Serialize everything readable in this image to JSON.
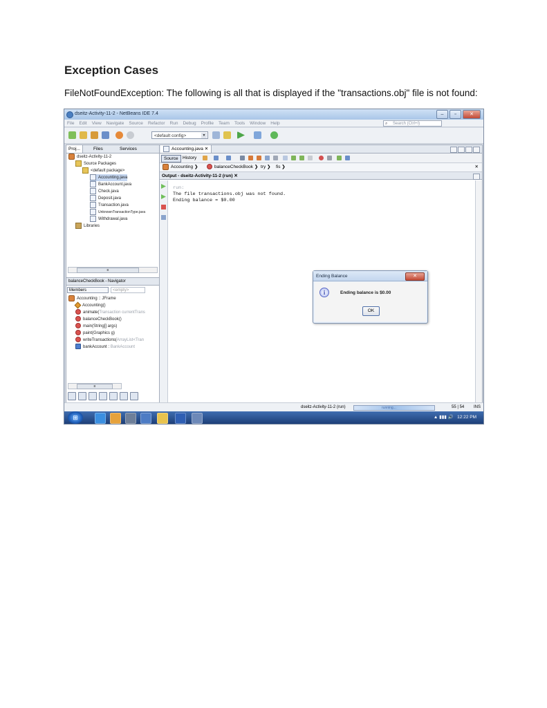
{
  "document": {
    "heading": "Exception Cases",
    "intro": "FileNotFoundException: The following is all that is displayed if the \"transactions.obj\" file is not found:"
  },
  "window": {
    "title": "dseitz-Activity-11-2 - NetBeans IDE 7.4",
    "buttons": [
      "–",
      "▫",
      "✕"
    ]
  },
  "menu": {
    "items": [
      "File",
      "Edit",
      "View",
      "Navigate",
      "Source",
      "Refactor",
      "Run",
      "Debug",
      "Profile",
      "Team",
      "Tools",
      "Window",
      "Help"
    ],
    "search_placeholder": "Search (Ctrl+I)"
  },
  "toolbar": {
    "config": "<default config>"
  },
  "projects": {
    "tabs": [
      "Proj...",
      "Files",
      "Services"
    ],
    "tree": [
      "dseitz-Activity-11-2",
      "Source Packages",
      "<default package>",
      "Accounting.java",
      "BankAccount.java",
      "Check.java",
      "Deposit.java",
      "Transaction.java",
      "UnknownTransactionType.java",
      "Withdrawal.java",
      "Libraries"
    ]
  },
  "navigator": {
    "title": "balanceCheckBook - Navigator",
    "filter": "Members",
    "empty": "<empty>",
    "items": [
      {
        "name": "Accounting :: JFrame"
      },
      {
        "name": "Accounting()"
      },
      {
        "name": "animate(Transaction currentTrans...",
        "prefix": "animate(",
        "muted": "Transaction currentTrans"
      },
      {
        "name": "balanceCheckBook()"
      },
      {
        "name": "main(String[] args)"
      },
      {
        "name": "paint(Graphics g)"
      },
      {
        "name": "writeTransactions(ArrayList<Tran",
        "prefix": "writeTransactions(",
        "muted": "ArrayList<Tran"
      },
      {
        "name": "bankAccount : BankAccount",
        "prefix": "bankAccount : ",
        "muted": "BankAccount"
      }
    ]
  },
  "editor": {
    "tab": "Accounting.java",
    "source_tab": "Source",
    "history_tab": "History",
    "breadcrumbs": [
      "Accounting",
      "balanceCheckBook",
      "try",
      "fis"
    ],
    "output_title": "Output - dseitz-Activity-11-2 (run)",
    "output_lines": [
      "run:",
      "The file transactions.obj was not found.",
      "Ending balance = $0.00"
    ]
  },
  "dialog": {
    "title": "Ending Balance",
    "message": "Ending balance is $0.00",
    "ok": "OK"
  },
  "status": {
    "run_label": "dseitz-Activity-11-2 (run)",
    "progress_text": "running...",
    "position": "55 | 54",
    "mode": "INS"
  },
  "taskbar": {
    "time": "12:22 PM"
  }
}
